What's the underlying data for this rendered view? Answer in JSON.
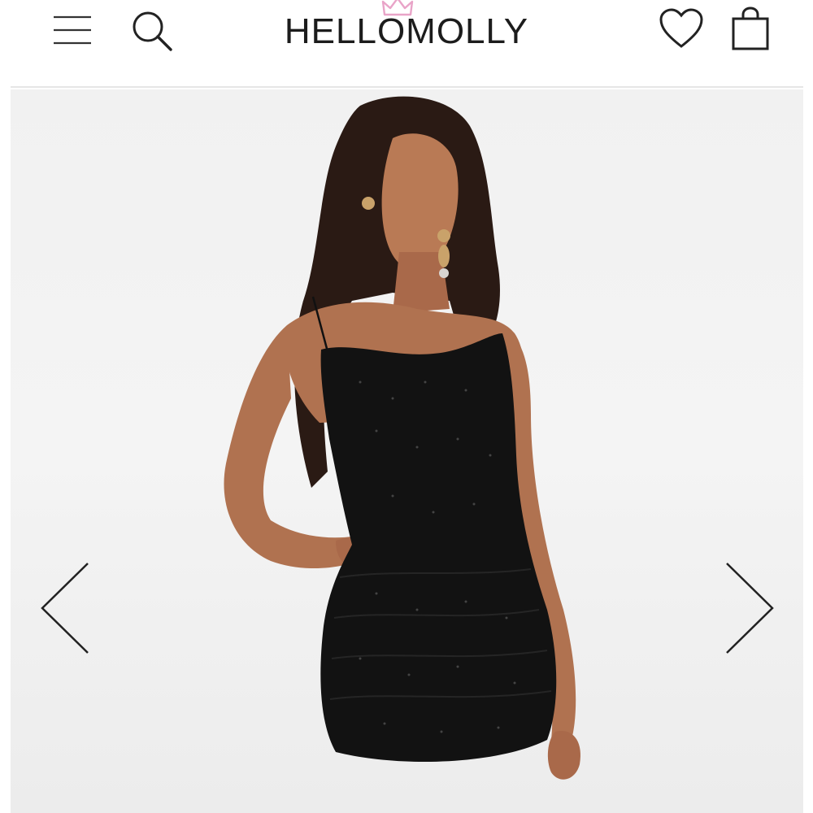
{
  "header": {
    "brand": "HELLOMOLLY",
    "menu_icon": "hamburger-menu-icon",
    "search_icon": "search-icon",
    "wishlist_icon": "heart-icon",
    "bag_icon": "shopping-bag-icon"
  },
  "gallery": {
    "image_subject": "model-in-black-glitter-one-shoulder-mini-dress",
    "prev_icon": "chevron-left-icon",
    "next_icon": "chevron-right-icon"
  },
  "colors": {
    "logo_text": "#1c1c1c",
    "crown": "#e9a4c8",
    "background": "#f2f2f2",
    "dress": "#121212"
  }
}
